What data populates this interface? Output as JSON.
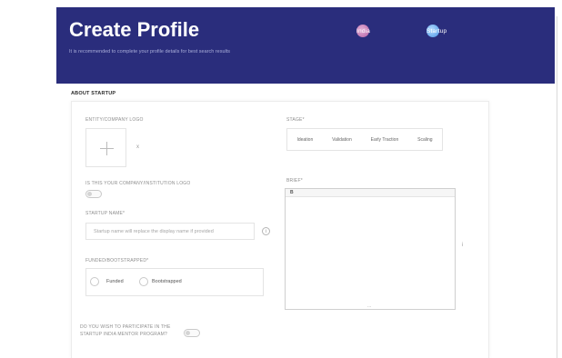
{
  "header": {
    "title": "Create Profile",
    "subtitle": "It is recommended to complete your profile details for best search results",
    "tags": [
      {
        "label": "India",
        "icon": "india-flag-icon"
      },
      {
        "label": "Startup",
        "icon": "rocket-icon"
      }
    ]
  },
  "section": {
    "title": "ABOUT STARTUP"
  },
  "form": {
    "logo_label": "ENTITY/COMPANY LOGO",
    "logo_upload_icon": "plus-icon",
    "logo_remove": "x",
    "same_logo_label": "IS THIS YOUR COMPANY/INSTITUTION LOGO",
    "startup_name_label": "STARTUP NAME*",
    "startup_name_placeholder": "Startup name will replace the display name if provided",
    "info_mark": "i",
    "funded_label": "FUNDED/BOOTSTRAPPED*",
    "funded_options": [
      "Funded",
      "Bootstrapped"
    ],
    "stage_label": "STAGE*",
    "stage_options": [
      "Ideation",
      "Validation",
      "Early Traction",
      "Scaling"
    ],
    "brief_label": "BRIEF*",
    "brief_toolbar_bold": "B",
    "brief_resize": "...",
    "brief_info": "i",
    "mentor_label": "DO YOU WISH TO PARTICIPATE IN THE STARTUP INDIA MENTOR PROGRAM?"
  },
  "colors": {
    "header_bg": "#2a2d7c",
    "header_text": "#ffffff"
  }
}
